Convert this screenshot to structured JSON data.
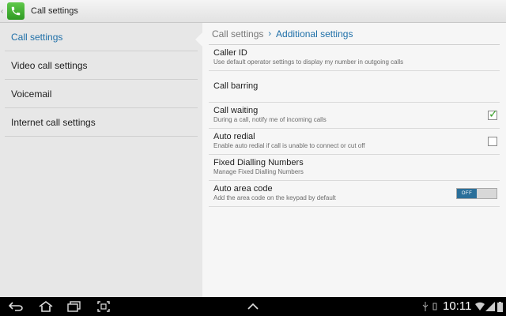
{
  "action_bar": {
    "title": "Call settings"
  },
  "left_menu": {
    "items": [
      {
        "label": "Call settings",
        "selected": true
      },
      {
        "label": "Video call settings",
        "selected": false
      },
      {
        "label": "Voicemail",
        "selected": false
      },
      {
        "label": "Internet call settings",
        "selected": false
      }
    ]
  },
  "breadcrumb": {
    "parent": "Call settings",
    "separator": "›",
    "current": "Additional settings"
  },
  "settings": [
    {
      "title": "Caller ID",
      "subtitle": "Use default operator settings to display my number in outgoing calls"
    },
    {
      "title": "Call barring"
    },
    {
      "title": "Call waiting",
      "subtitle": "During a call, notify me of incoming calls",
      "checked": true
    },
    {
      "title": "Auto redial",
      "subtitle": "Enable auto redial if call is unable to connect or cut off",
      "checked": false
    },
    {
      "title": "Fixed Dialling Numbers",
      "subtitle": "Manage Fixed Dialling Numbers"
    },
    {
      "title": "Auto area code",
      "subtitle": "Add the area code on the keypad by default",
      "toggle_label": "OFF"
    }
  ],
  "status_bar": {
    "time": "10:11"
  },
  "colors": {
    "accent": "#1e6fa8",
    "check": "#3a9f2a",
    "toggle": "#2a6f9a"
  }
}
